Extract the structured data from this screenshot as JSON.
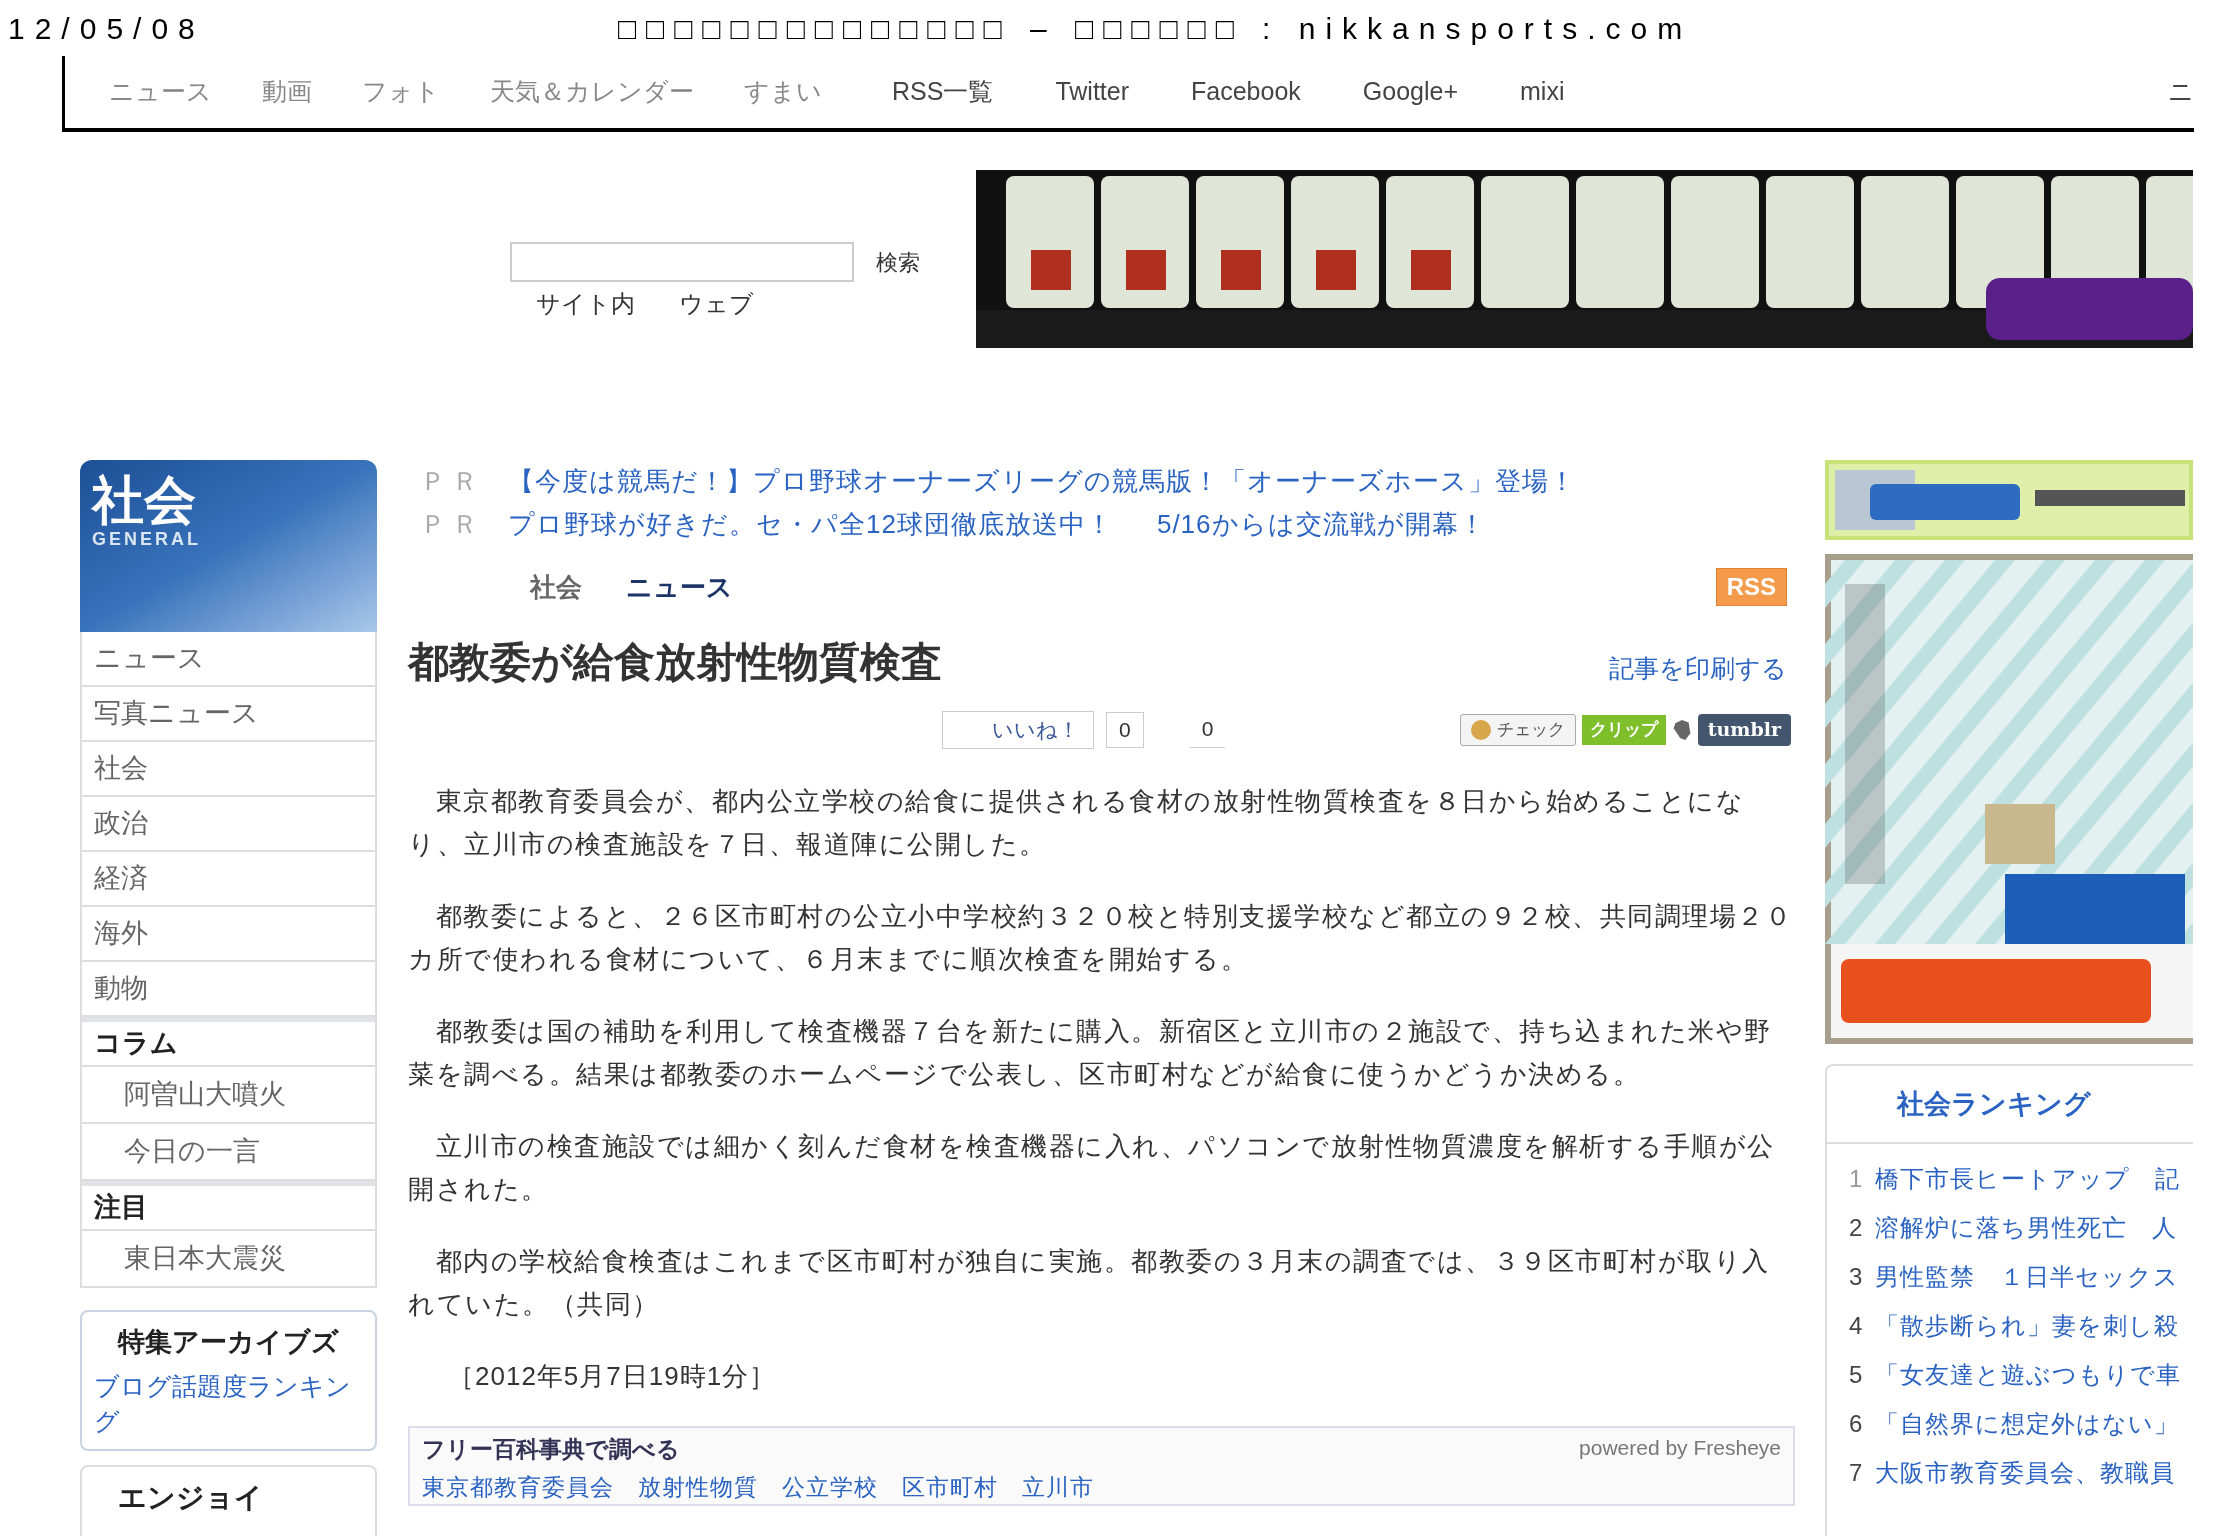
{
  "print_header": {
    "date": "12/05/08",
    "title": "□□□□□□□□□□□□□□ – □□□□□□ : nikkansports.com"
  },
  "nav": {
    "sections": [
      "ニュース",
      "動画",
      "フォト",
      "天気＆カレンダー",
      "すまい"
    ],
    "links": [
      "RSS一覧",
      "Twitter",
      "Facebook",
      "Google+",
      "mixi"
    ],
    "cut_item": "ニ"
  },
  "search": {
    "button": "検索",
    "scopes": [
      "サイト内",
      "ウェブ"
    ]
  },
  "sidebar": {
    "header": {
      "title": "社会",
      "subtitle": "GENERAL"
    },
    "items": [
      {
        "label": "ニュース",
        "kind": "item"
      },
      {
        "label": "写真ニュース",
        "kind": "item"
      },
      {
        "label": "社会",
        "kind": "item"
      },
      {
        "label": "政治",
        "kind": "item"
      },
      {
        "label": "経済",
        "kind": "item"
      },
      {
        "label": "海外",
        "kind": "item"
      },
      {
        "label": "動物",
        "kind": "item"
      },
      {
        "label": "コラム",
        "kind": "heading"
      },
      {
        "label": "阿曽山大噴火",
        "kind": "subitem"
      },
      {
        "label": "今日の一言",
        "kind": "subitem"
      },
      {
        "label": "注目",
        "kind": "heading"
      },
      {
        "label": "東日本大震災",
        "kind": "subitem"
      }
    ],
    "archive": {
      "title": "特集アーカイブズ",
      "link": "ブログ話題度ランキング"
    },
    "enjoy": {
      "title": "エンジョイ"
    }
  },
  "pr": [
    {
      "tag": "ＰＲ",
      "links": [
        "【今度は競馬だ！】プロ野球オーナーズリーグの競馬版！「オーナーズホース」登場！"
      ]
    },
    {
      "tag": "ＰＲ",
      "links": [
        "プロ野球が好きだ。セ・パ全12球団徹底放送中！",
        "5/16からは交流戦が開幕！"
      ]
    }
  ],
  "breadcrumb": [
    {
      "label": "社会",
      "selected": false
    },
    {
      "label": "ニュース",
      "selected": true
    }
  ],
  "rss": "RSS",
  "article": {
    "title": "都教委が給食放射性物質検査",
    "print_link": "記事を印刷する",
    "like": {
      "label": "いいね！",
      "count": "0"
    },
    "share_count": "0",
    "share_buttons": [
      {
        "label": "チェック",
        "kind": "mixi"
      },
      {
        "label": "クリップ",
        "kind": "clip"
      },
      {
        "kind": "evernote"
      },
      {
        "label": "tumblr",
        "kind": "tumblr"
      }
    ],
    "paragraphs": [
      "　東京都教育委員会が、都内公立学校の給食に提供される食材の放射性物質検査を８日から始めることになり、立川市の検査施設を７日、報道陣に公開した。",
      "　都教委によると、２６区市町村の公立小中学校約３２０校と特別支援学校など都立の９２校、共同調理場２０カ所で使われる食材について、６月末までに順次検査を開始する。",
      "　都教委は国の補助を利用して検査機器７台を新たに購入。新宿区と立川市の２施設で、持ち込まれた米や野菜を調べる。結果は都教委のホームページで公表し、区市町村などが給食に使うかどうか決める。",
      "　立川市の検査施設では細かく刻んだ食材を検査機器に入れ、パソコンで放射性物質濃度を解析する手順が公開された。",
      "　都内の学校給食検査はこれまで区市町村が独自に実施。都教委の３月末の調査では、３９区市町村が取り入れていた。（共同）"
    ],
    "date": "［2012年5月7日19時1分］"
  },
  "encyclopedia": {
    "title": "フリー百科事典で調べる",
    "credit": "powered by Fresheye",
    "terms": [
      "東京都教育委員会",
      "放射性物質",
      "公立学校",
      "区市町村",
      "立川市"
    ]
  },
  "ranking": {
    "title": "社会ランキング",
    "items": [
      {
        "rank": "1",
        "title": "橋下市長ヒートアップ　記"
      },
      {
        "rank": "2",
        "title": "溶解炉に落ち男性死亡　人"
      },
      {
        "rank": "3",
        "title": "男性監禁　１日半セックス"
      },
      {
        "rank": "4",
        "title": "「散歩断られ」妻を刺し殺"
      },
      {
        "rank": "5",
        "title": "「女友達と遊ぶつもりで車"
      },
      {
        "rank": "6",
        "title": "「自然界に想定外はない」"
      },
      {
        "rank": "7",
        "title": "大阪市教育委員会、教職員"
      }
    ]
  }
}
